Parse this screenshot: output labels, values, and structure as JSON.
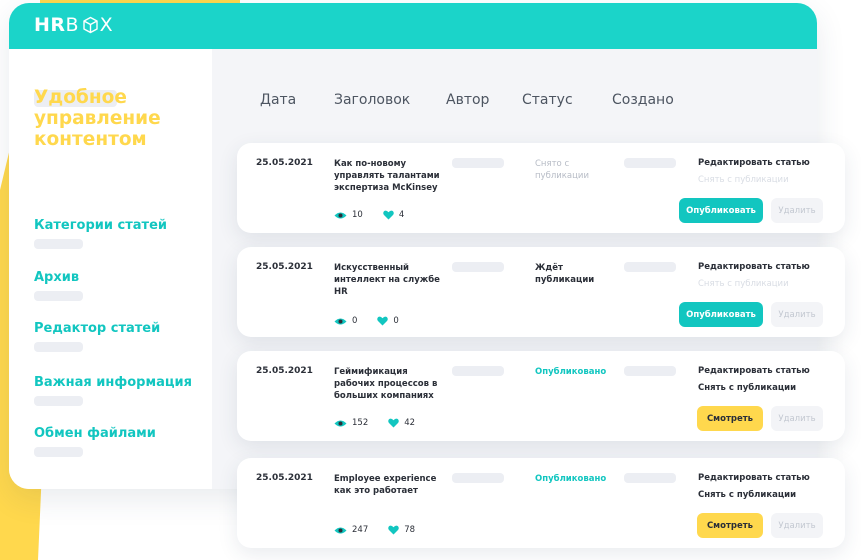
{
  "app": {
    "logo_bold": "HR",
    "logo_thin": "B",
    "logo_end": "X"
  },
  "sidebar": {
    "title": "Удобное управление контентом",
    "items": [
      {
        "label": "Категории статей"
      },
      {
        "label": "Архив"
      },
      {
        "label": "Редактор статей"
      },
      {
        "label": "Важная информация"
      },
      {
        "label": "Обмен файлами"
      }
    ]
  },
  "table": {
    "columns": [
      "Дата",
      "Заголовок",
      "Автор",
      "Статус",
      "Создано"
    ],
    "rows": [
      {
        "date": "25.05.2021",
        "title": "Как по-новому управлять талантами экспертиза McKinsey",
        "status": "Снято с публикации",
        "edit": "Редактировать статью",
        "unpublish": "Снять с публикации",
        "views": "10",
        "likes": "4",
        "primary_action": "Опубликовать",
        "delete": "Удалить"
      },
      {
        "date": "25.05.2021",
        "title": "Искусственный интеллект на службе HR",
        "status": "Ждёт публикации",
        "edit": "Редактировать статью",
        "unpublish": "Снять с публикации",
        "views": "0",
        "likes": "0",
        "primary_action": "Опубликовать",
        "delete": "Удалить"
      },
      {
        "date": "25.05.2021",
        "title": "Геймификация рабочих процессов в больших компаниях",
        "status": "Опубликовано",
        "edit": "Редактировать статью",
        "unpublish": "Снять с публикации",
        "views": "152",
        "likes": "42",
        "primary_action": "Смотреть",
        "delete": "Удалить"
      },
      {
        "date": "25.05.2021",
        "title": "Employee experience как это работает",
        "status": "Опубликовано",
        "edit": "Редактировать статью",
        "unpublish": "Снять с публикации",
        "views": "247",
        "likes": "78",
        "primary_action": "Смотреть",
        "delete": "Удалить"
      }
    ]
  },
  "colors": {
    "brand_teal": "#1bd4c9",
    "accent_yellow": "#ffd84d",
    "text_dark": "#2b2f38"
  },
  "icons": [
    "eye-icon",
    "heart-icon",
    "box-icon"
  ]
}
